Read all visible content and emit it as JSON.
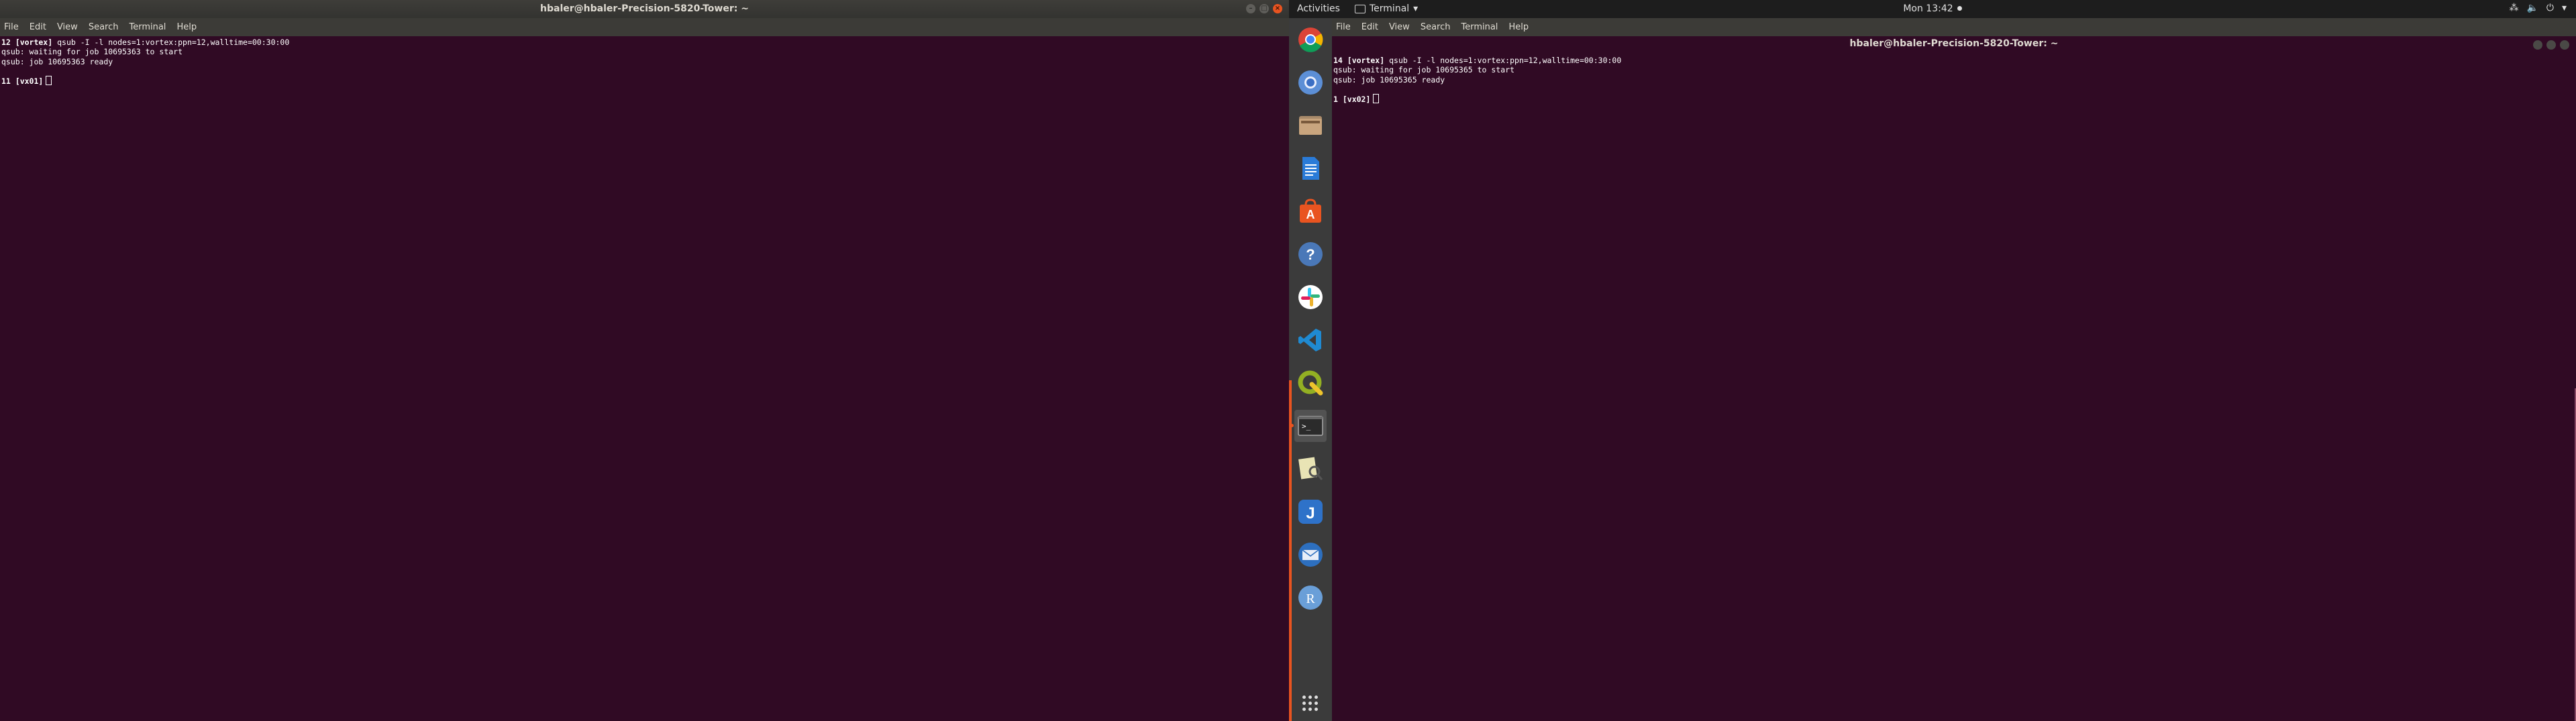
{
  "left_window": {
    "title": "hbaler@hbaler-Precision-5820-Tower: ~",
    "menu": [
      "File",
      "Edit",
      "View",
      "Search",
      "Terminal",
      "Help"
    ],
    "lines": [
      {
        "prompt": "12 [vortex]",
        "text": " qsub -I -l nodes=1:vortex:ppn=12,walltime=00:30:00"
      },
      {
        "prompt": "",
        "text": "qsub: waiting for job 10695363 to start"
      },
      {
        "prompt": "",
        "text": "qsub: job 10695363 ready"
      },
      {
        "prompt": "",
        "text": ""
      },
      {
        "prompt": "11 [vx01]",
        "text": " ",
        "cursor": true
      }
    ]
  },
  "top_panel": {
    "activities": "Activities",
    "app_name": "Terminal",
    "app_menu_arrow": "▾",
    "clock": "Mon 13:42",
    "tray": [
      "⁂",
      "🔈",
      "⏻",
      "▾"
    ]
  },
  "dock": {
    "items": [
      {
        "name": "chrome",
        "icon": "chrome-icon"
      },
      {
        "name": "chromium",
        "icon": "chromium-icon"
      },
      {
        "name": "files",
        "icon": "files-icon"
      },
      {
        "name": "writer",
        "icon": "document-icon"
      },
      {
        "name": "software",
        "icon": "software-center-icon"
      },
      {
        "name": "help",
        "icon": "help-icon"
      },
      {
        "name": "slack",
        "icon": "slack-icon"
      },
      {
        "name": "vscode",
        "icon": "vscode-icon"
      },
      {
        "name": "qgis",
        "icon": "qgis-icon"
      },
      {
        "name": "terminal",
        "icon": "terminal-icon",
        "active": true
      },
      {
        "name": "document-viewer",
        "icon": "document-viewer-icon"
      },
      {
        "name": "jabref",
        "icon": "jabref-icon"
      },
      {
        "name": "mail",
        "icon": "mail-icon"
      },
      {
        "name": "r",
        "icon": "r-icon"
      }
    ],
    "colors": {
      "accent": "#e95420"
    }
  },
  "right_window": {
    "title": "hbaler@hbaler-Precision-5820-Tower: ~",
    "menu": [
      "File",
      "Edit",
      "View",
      "Search",
      "Terminal",
      "Help"
    ],
    "lines": [
      {
        "prompt": "14 [vortex]",
        "text": " qsub -I -l nodes=1:vortex:ppn=12,walltime=00:30:00"
      },
      {
        "prompt": "",
        "text": "qsub: waiting for job 10695365 to start"
      },
      {
        "prompt": "",
        "text": "qsub: job 10695365 ready"
      },
      {
        "prompt": "",
        "text": ""
      },
      {
        "prompt": "1 [vx02]",
        "text": " ",
        "cursor": true
      }
    ]
  },
  "colors": {
    "terminal_bg": "#300a24",
    "panel_bg": "#1d1d1d",
    "dock_bg": "#3b3b3b"
  }
}
